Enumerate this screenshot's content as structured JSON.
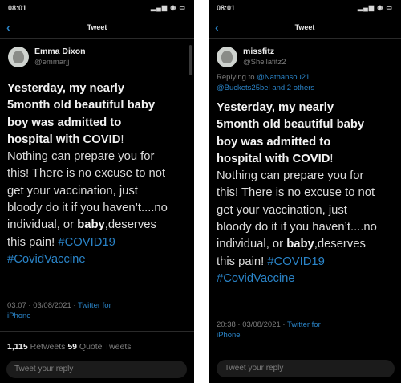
{
  "left": {
    "status": {
      "time": "08:01",
      "icons": "▂▄▆ ◉ ▭"
    },
    "nav": {
      "back": "‹",
      "title": "Tweet"
    },
    "author": {
      "name": "Emma Dixon",
      "handle": "@emmarjj"
    },
    "tweet": {
      "bold_lines": [
        "Yesterday, my nearly",
        "5month old beautiful baby",
        "boy was admitted to",
        "hospital with COVID"
      ],
      "excl": "!",
      "line5": "Nothing can prepare you for",
      "line6": "this! There is no excuse to not",
      "line7": "get your vaccination, just",
      "line8": "bloody do it if you haven’t....no",
      "line9_a": "individual, or ",
      "line9_b": "baby",
      "line9_c": ",deserves",
      "line10_a": "this pain! ",
      "hashtag1": "#COVID19",
      "hashtag2": "#CovidVaccine"
    },
    "meta": {
      "timestamp": "03:07 · 03/08/2021 · ",
      "client_line1": "Twitter for",
      "client_line2": "iPhone"
    },
    "counts": {
      "retweets_num": "1,115",
      "retweets_label": " Retweets ",
      "quotes_num": "59",
      "quotes_label": " Quote Tweets"
    },
    "reply_placeholder": "Tweet your reply"
  },
  "right": {
    "status": {
      "time": "08:01",
      "icons": "▂▄▆ ◉ ▭"
    },
    "nav": {
      "back": "‹",
      "title": "Tweet"
    },
    "author": {
      "name": "missfitz",
      "handle": "@Sheilafitz2"
    },
    "replying": {
      "prefix": "Replying to ",
      "mention1": "@Nathansou21",
      "line2": "@Buckets25bel and 2 others"
    },
    "tweet": {
      "bold_lines": [
        "Yesterday, my nearly",
        "5month old beautiful baby",
        "boy was admitted to",
        "hospital with COVID"
      ],
      "excl": "!",
      "line5": "Nothing can prepare you for",
      "line6": "this! There is no excuse to not",
      "line7": "get your vaccination, just",
      "line8": "bloody do it if you haven’t....no",
      "line9_a": "individual, or ",
      "line9_b": "baby",
      "line9_c": ",deserves",
      "line10_a": "this pain! ",
      "hashtag1": "#COVID19",
      "hashtag2": "#CovidVaccine"
    },
    "meta": {
      "timestamp": "20:38 · 03/08/2021 · ",
      "client_line1": "Twitter for",
      "client_line2": "iPhone"
    },
    "reply_placeholder": "Tweet your reply"
  }
}
